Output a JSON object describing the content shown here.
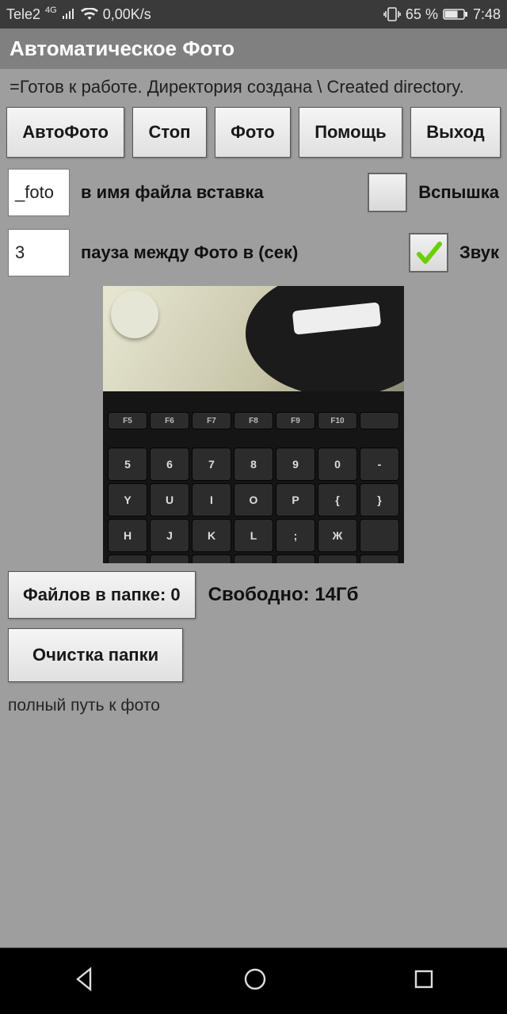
{
  "status_bar": {
    "carrier": "Tele2",
    "net_gen": "4G",
    "speed": "0,00K/s",
    "battery_pct": "65 %",
    "time": "7:48"
  },
  "app": {
    "title": "Автоматическое Фото"
  },
  "status_line": "=Готов к работе. Директория создана \\ Created directory.",
  "buttons": {
    "auto": "АвтоФото",
    "stop": "Стоп",
    "photo": "Фото",
    "help": "Помощь",
    "exit": "Выход"
  },
  "filename": {
    "value": "_foto",
    "label": "в имя файла вставка"
  },
  "flash": {
    "checked": false,
    "label": "Вспышка"
  },
  "pause": {
    "value": "3",
    "label": "пауза между Фото в (сек)"
  },
  "sound": {
    "checked": true,
    "label": "Звук"
  },
  "files_btn": "Файлов в папке: 0",
  "free_label": "Свободно: 14Гб",
  "clear_btn": "Очистка папки",
  "path_label": "полный путь к фото"
}
